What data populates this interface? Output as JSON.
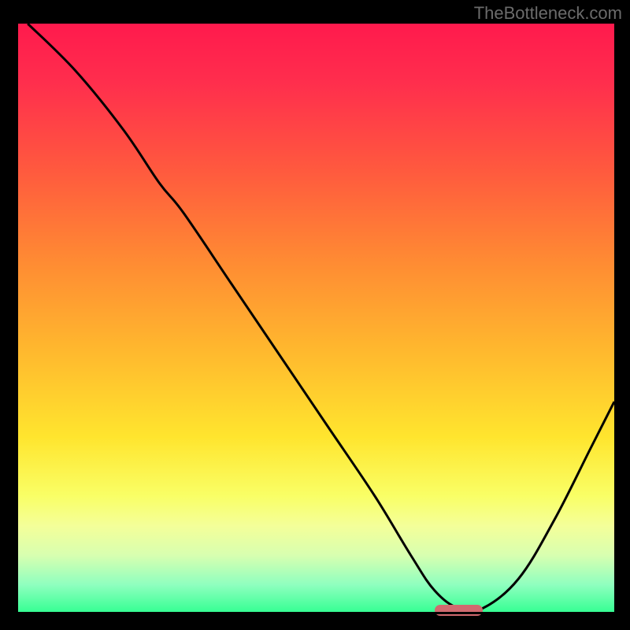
{
  "watermark": "TheBottleneck.com",
  "chart_data": {
    "type": "line",
    "title": "",
    "xlabel": "",
    "ylabel": "",
    "xlim": [
      0,
      100
    ],
    "ylim": [
      0,
      100
    ],
    "x": [
      2,
      10,
      18,
      24,
      28,
      36,
      44,
      52,
      60,
      66,
      70,
      74,
      78,
      84,
      90,
      96,
      100
    ],
    "values": [
      100,
      92,
      82,
      73,
      68,
      56,
      44,
      32,
      20,
      10,
      4,
      1,
      1,
      6,
      16,
      28,
      36
    ],
    "marker": {
      "x_start": 70,
      "x_end": 78,
      "y": 0.5
    }
  },
  "colors": {
    "curve": "#000000",
    "marker": "#d16a6f"
  }
}
